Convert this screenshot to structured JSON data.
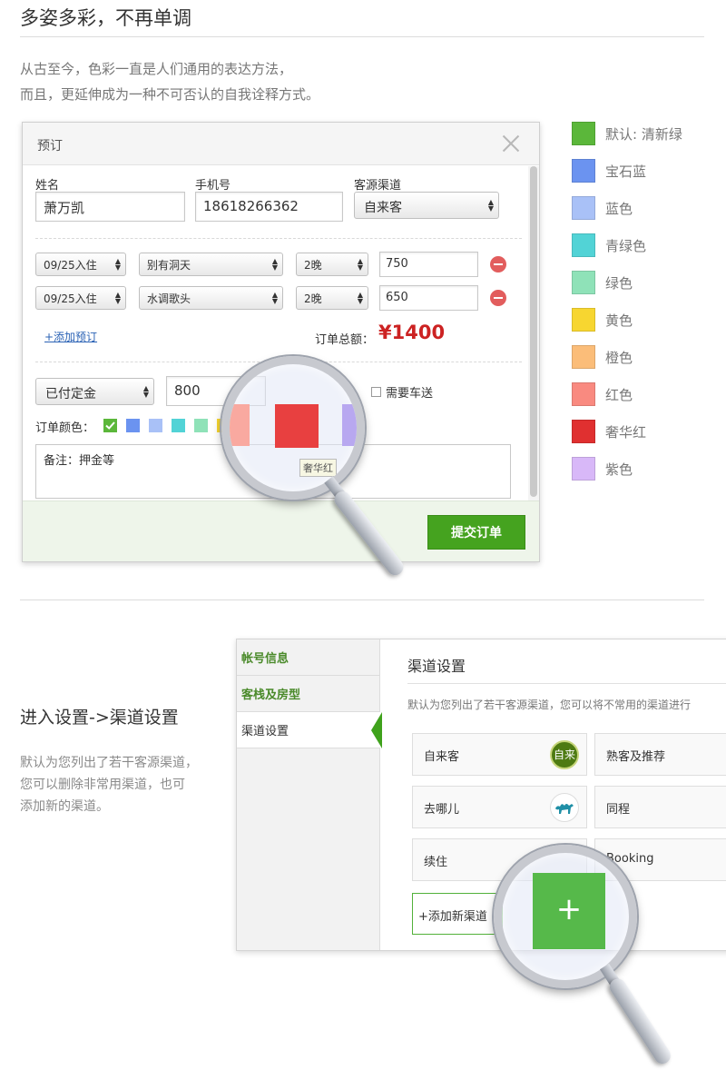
{
  "section1": {
    "title": "多姿多彩，不再单调",
    "intro_line1": "从古至今，色彩一直是人们通用的表达方法，",
    "intro_line2": "而且，更延伸成为一种不可否认的自我诠释方式。"
  },
  "dialog": {
    "title": "预订",
    "fields": {
      "name_label": "姓名",
      "name_value": "萧万凯",
      "phone_label": "手机号",
      "phone_value": "18618266362",
      "source_label": "客源渠道",
      "source_value": "自来客"
    },
    "bookings": [
      {
        "date": "09/25入住",
        "room": "别有洞天",
        "nights": "2晚",
        "price": "750"
      },
      {
        "date": "09/25入住",
        "room": "水调歌头",
        "nights": "2晚",
        "price": "650"
      }
    ],
    "add_booking": "+添加预订",
    "total_label": "订单总额：",
    "total_value": "¥1400",
    "payment_status": "已付定金",
    "deposit": "800",
    "pickup_label": "需要车送",
    "order_color_label": "订单颜色：",
    "order_colors": [
      "#5bb73a",
      "#6b93f0",
      "#a9c1f7",
      "#52d3d6",
      "#8fe2b8",
      "#f7d630"
    ],
    "notes": "备注：押金等",
    "submit": "提交订单"
  },
  "magnifier1": {
    "swatches": [
      "#f9a9a0",
      "#e84040",
      "#b8a8f0"
    ],
    "tooltip": "奢华红"
  },
  "legend": [
    {
      "label": "默认: 清新绿",
      "color": "#5bb73a"
    },
    {
      "label": "宝石蓝",
      "color": "#6b93f0"
    },
    {
      "label": "蓝色",
      "color": "#a9c1f7"
    },
    {
      "label": "青绿色",
      "color": "#52d3d6"
    },
    {
      "label": "绿色",
      "color": "#8fe2b8"
    },
    {
      "label": "黄色",
      "color": "#f7d630"
    },
    {
      "label": "橙色",
      "color": "#fbbd79"
    },
    {
      "label": "红色",
      "color": "#f98a80"
    },
    {
      "label": "奢华红",
      "color": "#e03030"
    },
    {
      "label": "紫色",
      "color": "#d8b8f8"
    }
  ],
  "section2": {
    "title": "进入设置->渠道设置",
    "desc_line1": "默认为您列出了若干客源渠道，",
    "desc_line2": "您可以删除非常用渠道，也可",
    "desc_line3": "添加新的渠道。"
  },
  "settings": {
    "sidebar": [
      "帐号信息",
      "客栈及房型",
      "渠道设置"
    ],
    "title": "渠道设置",
    "description": "默认为您列出了若干客源渠道，您可以将不常用的渠道进行",
    "channels": [
      "自来客",
      "熟客及推荐",
      "去哪儿",
      "同程",
      "续住",
      "Booking"
    ],
    "logo_text": "自来",
    "add_channel": "+添加新渠道"
  }
}
